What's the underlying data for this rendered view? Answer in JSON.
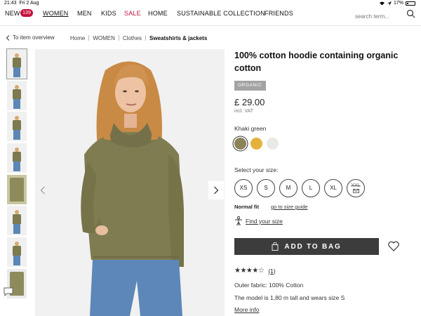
{
  "status": {
    "time": "21:43",
    "date": "Fri 2 Aug",
    "battery": "17%",
    "icons": [
      "wifi-icon",
      "battery-icon"
    ]
  },
  "nav": {
    "new": "NEW",
    "new_count": "139",
    "women": "WOMEN",
    "men": "MEN",
    "kids": "KIDS",
    "sale": "SALE",
    "home": "HOME",
    "sustainable": "SUSTAINABLE COLLECTION",
    "friends": "FRIENDS",
    "search_placeholder": "search term...",
    "sale_color": "#c4123b"
  },
  "breadcrumb": {
    "back": "To item overview",
    "items": [
      "Home",
      "WOMEN",
      "Clothes",
      "Sweatshirts & jackets"
    ]
  },
  "gallery": {
    "thumb_count": 8,
    "selected": 0
  },
  "product": {
    "title": "100% cotton hoodie containing organic cotton",
    "tag": "ORGANIC",
    "price": "£ 29.00",
    "vat": "incl. VAT",
    "color_name": "Khaki green",
    "swatches": [
      {
        "name": "khaki-green",
        "hex": "#8a8458",
        "selected": true
      },
      {
        "name": "yellow",
        "hex": "#e4b23c",
        "selected": false
      },
      {
        "name": "off-white",
        "hex": "#e9e9e6",
        "selected": false
      }
    ],
    "size_label": "Select your size:",
    "sizes": [
      "XS",
      "S",
      "M",
      "L",
      "XL",
      "XXL"
    ],
    "fit": "Normal fit",
    "size_guide": "go to size guide",
    "find_size": "Find your size",
    "add_to_bag": "ADD TO BAG",
    "rating": 4,
    "rating_max": 5,
    "rating_stars": "★★★★☆",
    "review_count": "(1)",
    "fabric": "Outer fabric: 100% Cotton",
    "model": "The model is 1,80 m tall and wears size S",
    "more_info": "More info"
  }
}
